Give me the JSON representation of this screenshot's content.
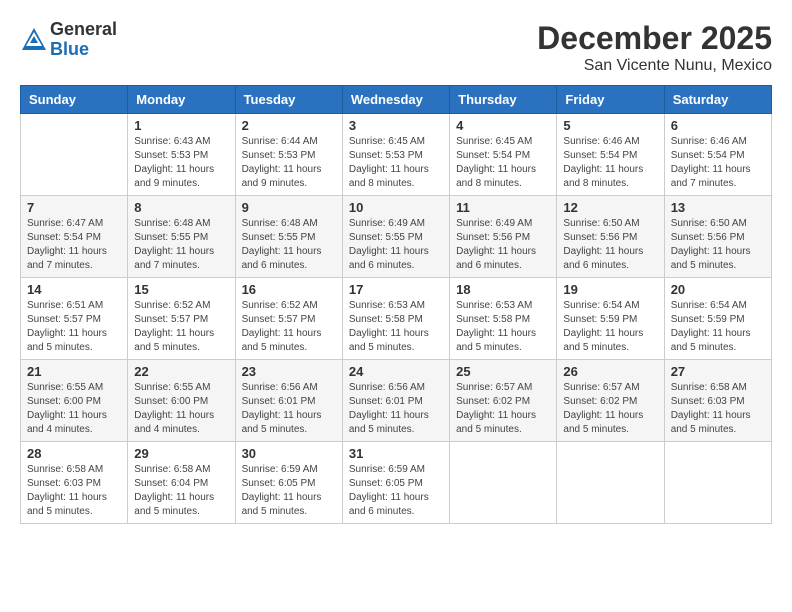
{
  "header": {
    "logo_general": "General",
    "logo_blue": "Blue",
    "month_year": "December 2025",
    "location": "San Vicente Nunu, Mexico"
  },
  "calendar": {
    "weekdays": [
      "Sunday",
      "Monday",
      "Tuesday",
      "Wednesday",
      "Thursday",
      "Friday",
      "Saturday"
    ],
    "weeks": [
      [
        {
          "day": "",
          "sunrise": "",
          "sunset": "",
          "daylight": ""
        },
        {
          "day": "1",
          "sunrise": "Sunrise: 6:43 AM",
          "sunset": "Sunset: 5:53 PM",
          "daylight": "Daylight: 11 hours and 9 minutes."
        },
        {
          "day": "2",
          "sunrise": "Sunrise: 6:44 AM",
          "sunset": "Sunset: 5:53 PM",
          "daylight": "Daylight: 11 hours and 9 minutes."
        },
        {
          "day": "3",
          "sunrise": "Sunrise: 6:45 AM",
          "sunset": "Sunset: 5:53 PM",
          "daylight": "Daylight: 11 hours and 8 minutes."
        },
        {
          "day": "4",
          "sunrise": "Sunrise: 6:45 AM",
          "sunset": "Sunset: 5:54 PM",
          "daylight": "Daylight: 11 hours and 8 minutes."
        },
        {
          "day": "5",
          "sunrise": "Sunrise: 6:46 AM",
          "sunset": "Sunset: 5:54 PM",
          "daylight": "Daylight: 11 hours and 8 minutes."
        },
        {
          "day": "6",
          "sunrise": "Sunrise: 6:46 AM",
          "sunset": "Sunset: 5:54 PM",
          "daylight": "Daylight: 11 hours and 7 minutes."
        }
      ],
      [
        {
          "day": "7",
          "sunrise": "Sunrise: 6:47 AM",
          "sunset": "Sunset: 5:54 PM",
          "daylight": "Daylight: 11 hours and 7 minutes."
        },
        {
          "day": "8",
          "sunrise": "Sunrise: 6:48 AM",
          "sunset": "Sunset: 5:55 PM",
          "daylight": "Daylight: 11 hours and 7 minutes."
        },
        {
          "day": "9",
          "sunrise": "Sunrise: 6:48 AM",
          "sunset": "Sunset: 5:55 PM",
          "daylight": "Daylight: 11 hours and 6 minutes."
        },
        {
          "day": "10",
          "sunrise": "Sunrise: 6:49 AM",
          "sunset": "Sunset: 5:55 PM",
          "daylight": "Daylight: 11 hours and 6 minutes."
        },
        {
          "day": "11",
          "sunrise": "Sunrise: 6:49 AM",
          "sunset": "Sunset: 5:56 PM",
          "daylight": "Daylight: 11 hours and 6 minutes."
        },
        {
          "day": "12",
          "sunrise": "Sunrise: 6:50 AM",
          "sunset": "Sunset: 5:56 PM",
          "daylight": "Daylight: 11 hours and 6 minutes."
        },
        {
          "day": "13",
          "sunrise": "Sunrise: 6:50 AM",
          "sunset": "Sunset: 5:56 PM",
          "daylight": "Daylight: 11 hours and 5 minutes."
        }
      ],
      [
        {
          "day": "14",
          "sunrise": "Sunrise: 6:51 AM",
          "sunset": "Sunset: 5:57 PM",
          "daylight": "Daylight: 11 hours and 5 minutes."
        },
        {
          "day": "15",
          "sunrise": "Sunrise: 6:52 AM",
          "sunset": "Sunset: 5:57 PM",
          "daylight": "Daylight: 11 hours and 5 minutes."
        },
        {
          "day": "16",
          "sunrise": "Sunrise: 6:52 AM",
          "sunset": "Sunset: 5:57 PM",
          "daylight": "Daylight: 11 hours and 5 minutes."
        },
        {
          "day": "17",
          "sunrise": "Sunrise: 6:53 AM",
          "sunset": "Sunset: 5:58 PM",
          "daylight": "Daylight: 11 hours and 5 minutes."
        },
        {
          "day": "18",
          "sunrise": "Sunrise: 6:53 AM",
          "sunset": "Sunset: 5:58 PM",
          "daylight": "Daylight: 11 hours and 5 minutes."
        },
        {
          "day": "19",
          "sunrise": "Sunrise: 6:54 AM",
          "sunset": "Sunset: 5:59 PM",
          "daylight": "Daylight: 11 hours and 5 minutes."
        },
        {
          "day": "20",
          "sunrise": "Sunrise: 6:54 AM",
          "sunset": "Sunset: 5:59 PM",
          "daylight": "Daylight: 11 hours and 5 minutes."
        }
      ],
      [
        {
          "day": "21",
          "sunrise": "Sunrise: 6:55 AM",
          "sunset": "Sunset: 6:00 PM",
          "daylight": "Daylight: 11 hours and 4 minutes."
        },
        {
          "day": "22",
          "sunrise": "Sunrise: 6:55 AM",
          "sunset": "Sunset: 6:00 PM",
          "daylight": "Daylight: 11 hours and 4 minutes."
        },
        {
          "day": "23",
          "sunrise": "Sunrise: 6:56 AM",
          "sunset": "Sunset: 6:01 PM",
          "daylight": "Daylight: 11 hours and 5 minutes."
        },
        {
          "day": "24",
          "sunrise": "Sunrise: 6:56 AM",
          "sunset": "Sunset: 6:01 PM",
          "daylight": "Daylight: 11 hours and 5 minutes."
        },
        {
          "day": "25",
          "sunrise": "Sunrise: 6:57 AM",
          "sunset": "Sunset: 6:02 PM",
          "daylight": "Daylight: 11 hours and 5 minutes."
        },
        {
          "day": "26",
          "sunrise": "Sunrise: 6:57 AM",
          "sunset": "Sunset: 6:02 PM",
          "daylight": "Daylight: 11 hours and 5 minutes."
        },
        {
          "day": "27",
          "sunrise": "Sunrise: 6:58 AM",
          "sunset": "Sunset: 6:03 PM",
          "daylight": "Daylight: 11 hours and 5 minutes."
        }
      ],
      [
        {
          "day": "28",
          "sunrise": "Sunrise: 6:58 AM",
          "sunset": "Sunset: 6:03 PM",
          "daylight": "Daylight: 11 hours and 5 minutes."
        },
        {
          "day": "29",
          "sunrise": "Sunrise: 6:58 AM",
          "sunset": "Sunset: 6:04 PM",
          "daylight": "Daylight: 11 hours and 5 minutes."
        },
        {
          "day": "30",
          "sunrise": "Sunrise: 6:59 AM",
          "sunset": "Sunset: 6:05 PM",
          "daylight": "Daylight: 11 hours and 5 minutes."
        },
        {
          "day": "31",
          "sunrise": "Sunrise: 6:59 AM",
          "sunset": "Sunset: 6:05 PM",
          "daylight": "Daylight: 11 hours and 6 minutes."
        },
        {
          "day": "",
          "sunrise": "",
          "sunset": "",
          "daylight": ""
        },
        {
          "day": "",
          "sunrise": "",
          "sunset": "",
          "daylight": ""
        },
        {
          "day": "",
          "sunrise": "",
          "sunset": "",
          "daylight": ""
        }
      ]
    ]
  }
}
